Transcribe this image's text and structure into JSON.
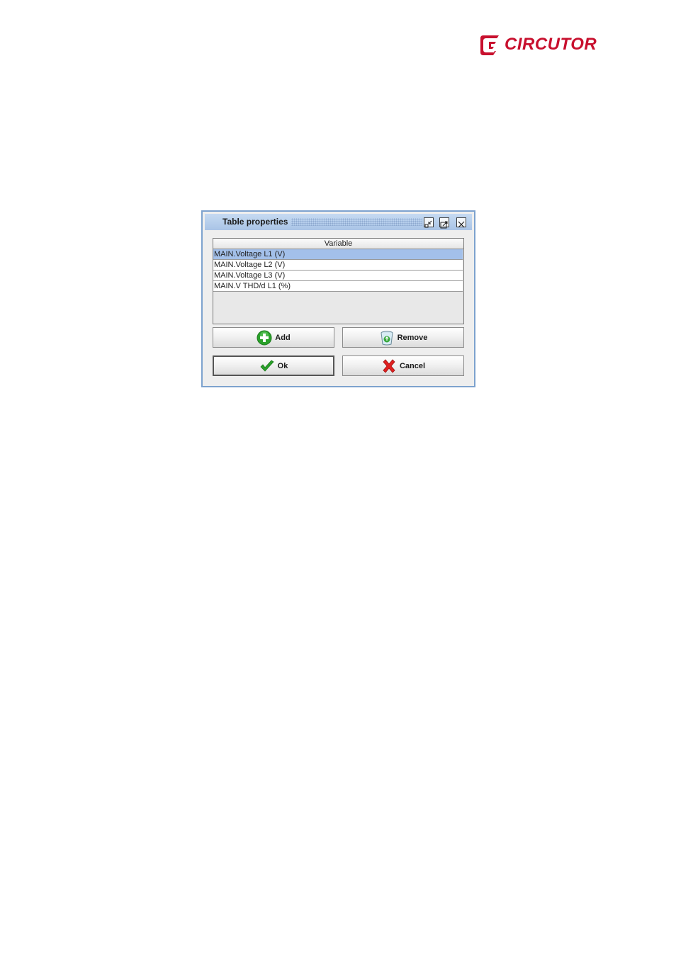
{
  "logo": {
    "text": "CIRCUTOR",
    "color": "#c8102e"
  },
  "dialog": {
    "title": "Table properties",
    "controls": {
      "minimize_icon": "minimize-icon",
      "maximize_icon": "maximize-icon",
      "close_icon": "close-icon"
    },
    "table": {
      "header": "Variable",
      "rows": [
        "MAIN.Voltage L1 (V)",
        "MAIN.Voltage L2 (V)",
        "MAIN.Voltage L3 (V)",
        "MAIN.V THD/d L1 (%)"
      ],
      "selected_index": 0
    },
    "buttons": {
      "add": "Add",
      "remove": "Remove",
      "ok": "Ok",
      "cancel": "Cancel"
    }
  },
  "colors": {
    "title_bar": "#a9c4e6",
    "selection": "#a3c0ea",
    "add_icon": "#2aa12a",
    "cancel_icon": "#e02020"
  }
}
